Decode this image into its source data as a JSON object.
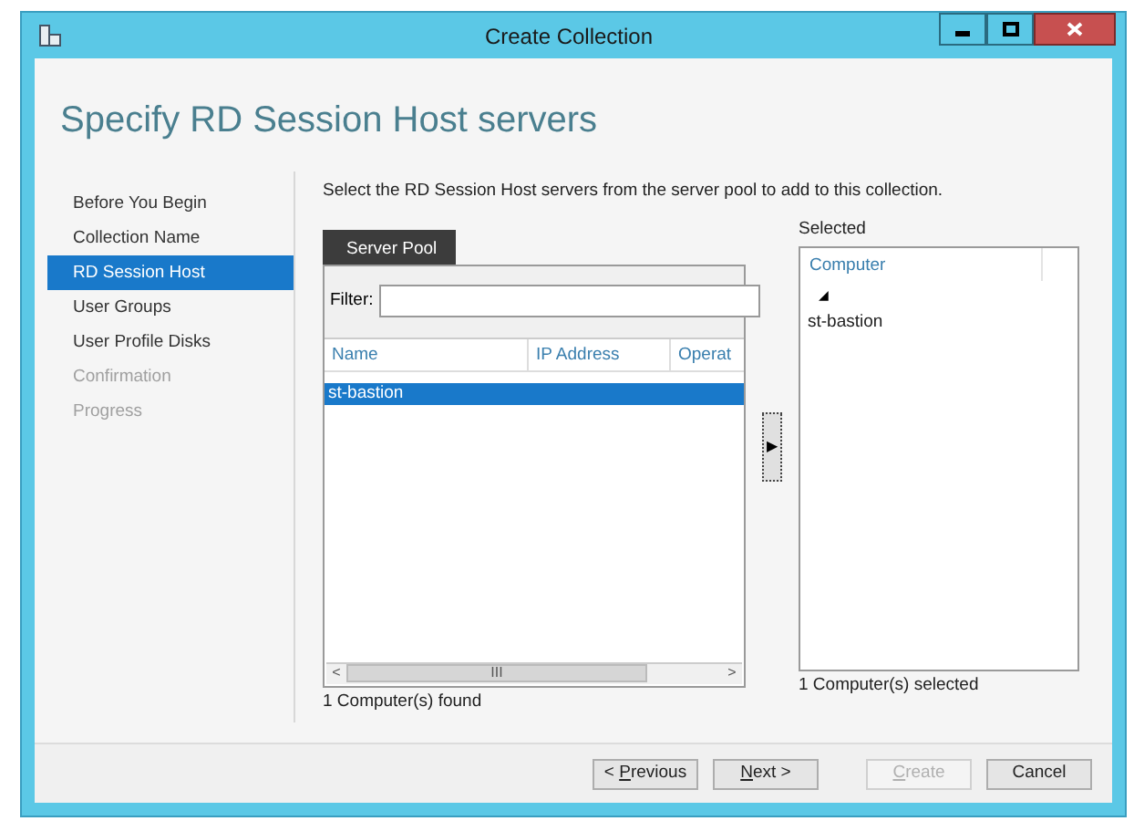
{
  "window": {
    "title": "Create Collection"
  },
  "heading": "Specify RD Session Host servers",
  "steps": [
    {
      "label": "Before You Begin",
      "selected": false,
      "disabled": false
    },
    {
      "label": "Collection Name",
      "selected": false,
      "disabled": false
    },
    {
      "label": "RD Session Host",
      "selected": true,
      "disabled": false
    },
    {
      "label": "User Groups",
      "selected": false,
      "disabled": false
    },
    {
      "label": "User Profile Disks",
      "selected": false,
      "disabled": false
    },
    {
      "label": "Confirmation",
      "selected": false,
      "disabled": true
    },
    {
      "label": "Progress",
      "selected": false,
      "disabled": true
    }
  ],
  "instruction": "Select the RD Session Host servers from the server pool to add to this collection.",
  "server_pool": {
    "tab": "Server Pool",
    "filter_label": "Filter:",
    "columns": [
      "Name",
      "IP Address",
      "Operat"
    ],
    "rows": [
      {
        "name": "st-bastion",
        "selected": true
      }
    ],
    "scroll_mark": "III",
    "scroll_left": "<",
    "scroll_right": ">",
    "status": "1 Computer(s) found"
  },
  "add_button": "▶",
  "selected_list": {
    "label": "Selected",
    "column": "Computer",
    "sort_mark": "◢",
    "rows": [
      "st-bastion"
    ],
    "status": "1 Computer(s) selected"
  },
  "buttons": [
    {
      "before": "< ",
      "key": "P",
      "after": "revious",
      "disabled": false
    },
    {
      "key": "N",
      "after": "ext >",
      "disabled": false
    },
    {
      "key": "C",
      "after": "reate",
      "disabled": true
    },
    {
      "after": "Cancel",
      "disabled": false
    }
  ]
}
